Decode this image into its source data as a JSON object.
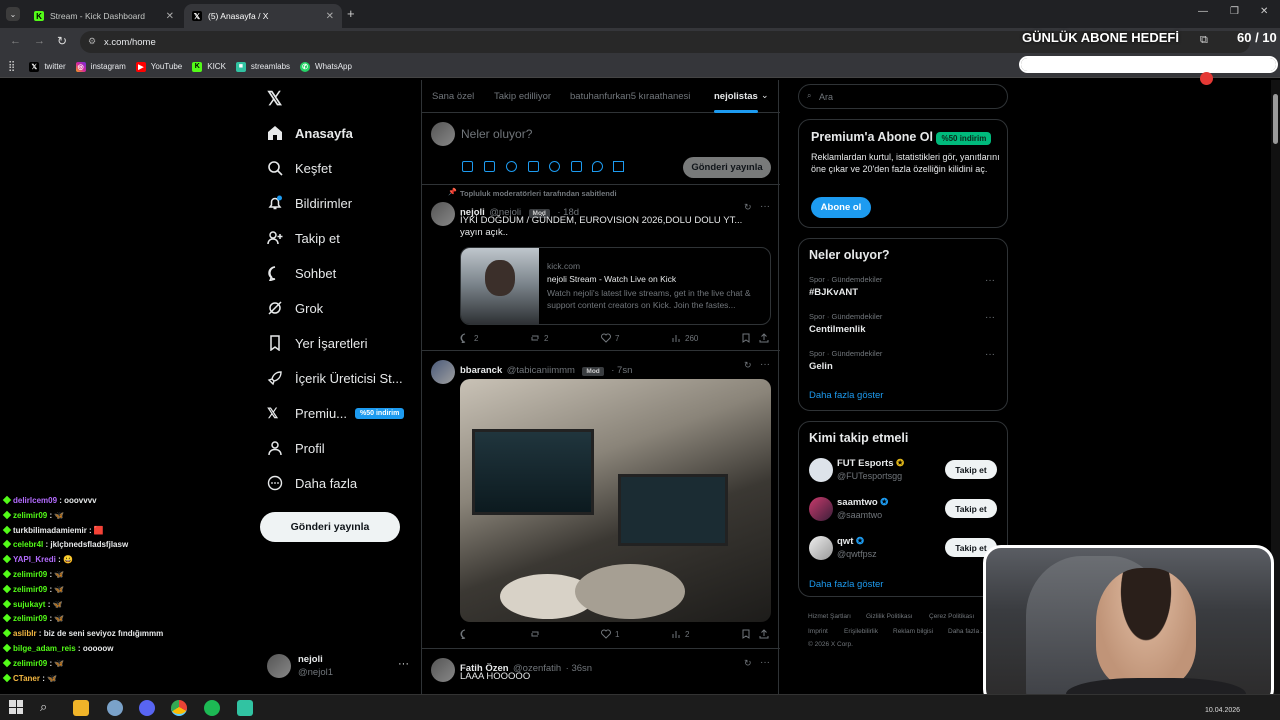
{
  "browser": {
    "tabs": [
      {
        "title": "Stream - Kick Dashboard",
        "icon": "kick-icon"
      },
      {
        "title": "(5) Anasayfa / X",
        "icon": "x-logo-icon"
      }
    ],
    "url": "x.com/home",
    "bookmarks": [
      {
        "label": "twitter",
        "icon": "x-logo-icon"
      },
      {
        "label": "instagram",
        "icon": "instagram-icon"
      },
      {
        "label": "YouTube",
        "icon": "youtube-icon"
      },
      {
        "label": "KICK",
        "icon": "kick-icon"
      },
      {
        "label": "streamlabs",
        "icon": "streamlabs-icon"
      },
      {
        "label": "WhatsApp",
        "icon": "whatsapp-icon"
      }
    ]
  },
  "overlay": {
    "goal_title": "GÜNLÜK ABONE HEDEFİ",
    "goal_count": "60 / 10",
    "goal_progress": 1.0
  },
  "nav": {
    "items": [
      {
        "label": "Anasayfa",
        "icon": "home-icon"
      },
      {
        "label": "Keşfet",
        "icon": "search-icon"
      },
      {
        "label": "Bildirimler",
        "icon": "bell-icon"
      },
      {
        "label": "Takip et",
        "icon": "add-person-icon"
      },
      {
        "label": "Sohbet",
        "icon": "chat-bubble-icon"
      },
      {
        "label": "Grok",
        "icon": "grok-icon"
      },
      {
        "label": "Yer İşaretleri",
        "icon": "bookmark-icon"
      },
      {
        "label": "İçerik Üreticisi St...",
        "icon": "rocket-icon"
      },
      {
        "label": "Premiu...",
        "icon": "x-logo-icon"
      },
      {
        "label": "Profil",
        "icon": "person-icon"
      },
      {
        "label": "Daha fazla",
        "icon": "more-circle-icon"
      }
    ],
    "premium_badge": "%50 indirim",
    "post_button": "Gönderi yayınla",
    "account": {
      "name": "nejoli",
      "handle": "@nejol1"
    }
  },
  "timeline": {
    "tabs": [
      "Sana özel",
      "Takip edilliyor",
      "batuhanfurkan5 kıraathanesi",
      "nejolistas"
    ],
    "composer": {
      "placeholder": "Neler oluyor?",
      "post_button": "Gönderi yayınla"
    },
    "pinned_label": "Topluluk moderatörleri tarafından sabitlendi",
    "posts": [
      {
        "name": "nejoli",
        "handle": "@nejoli",
        "badge": "Mod",
        "time": "18d",
        "text_line1": "İYKİ DOĞDUM / GÜNDEM, EUROVISION 2026,DOLU DOLU YT...",
        "text_line2": "yayın açık..",
        "card": {
          "domain": "kick.com",
          "title": "nejoli Stream - Watch Live on Kick",
          "description": "Watch nejoli's latest live streams, get in the live chat & support content creators on Kick. Join the fastes..."
        },
        "replies": "2",
        "reposts": "2",
        "likes": "7",
        "views": "260"
      },
      {
        "name": "bbaranck",
        "handle": "@tabicaniimmm",
        "badge": "Mod",
        "time": "7sn",
        "replies": "",
        "reposts": "",
        "likes": "1",
        "views": "2"
      },
      {
        "name": "Fatih Özen",
        "handle": "@ozenfatih",
        "time": "36sn",
        "text": "LAAA HOOOOO"
      }
    ]
  },
  "sidebar": {
    "search_placeholder": "Ara",
    "premium": {
      "title": "Premium'a Abone Ol",
      "badge": "%50 indirim",
      "text": "Reklamlardan kurtul, istatistikleri gör, yanıtlarını öne çıkar ve 20'den fazla özelliğin kilidini aç.",
      "button": "Abone ol"
    },
    "trends": {
      "title": "Neler oluyor?",
      "items": [
        {
          "category": "Spor · Gündemdekiler",
          "name": "#BJKvANT"
        },
        {
          "category": "Spor · Gündemdekiler",
          "name": "Centilmenlik"
        },
        {
          "category": "Spor · Gündemdekiler",
          "name": "Gelin"
        }
      ],
      "more": "Daha fazla göster"
    },
    "who_to_follow": {
      "title": "Kimi takip etmeli",
      "accounts": [
        {
          "name": "FUT Esports",
          "handle": "@FUTesportsgg",
          "verified": "gold"
        },
        {
          "name": "saamtwo",
          "handle": "@saamtwo",
          "verified": "blue"
        },
        {
          "name": "qwt",
          "handle": "@qwtfpsz",
          "verified": "blue"
        }
      ],
      "follow_button": "Takip et",
      "more": "Daha fazla göster"
    },
    "footer": [
      "Hizmet Şartları",
      "Gizlilik Politikası",
      "Çerez Politikası",
      "Imprint",
      "Erişilebilirlik",
      "Reklam bilgisi",
      "Daha fazla ...",
      "© 2026 X Corp."
    ]
  },
  "chat": {
    "lines": [
      {
        "user": "delirlcem09",
        "message": "ooovvvv",
        "color": "#b46cff"
      },
      {
        "user": "zelimir09",
        "message": "🦋",
        "color": "#53fc18"
      },
      {
        "user": "turkbilimadamiemir",
        "message": "🟥",
        "color": "#e7e9ea"
      },
      {
        "user": "celebr4l",
        "message": "jklçbnedsfladsfjlasw",
        "color": "#53fc18"
      },
      {
        "user": "YAPI_Kredi",
        "message": "😀",
        "color": "#b46cff"
      },
      {
        "user": "zelimir09",
        "message": "🦋",
        "color": "#53fc18"
      },
      {
        "user": "zelimir09",
        "message": "🦋",
        "color": "#53fc18"
      },
      {
        "user": "sujukayt",
        "message": "🦋",
        "color": "#53fc18"
      },
      {
        "user": "zelimir09",
        "message": "🦋",
        "color": "#53fc18"
      },
      {
        "user": "aslibIr",
        "message": "biz de seni seviyoz fındığımmm",
        "color": "#f5b942"
      },
      {
        "user": "bilge_adam_reis",
        "message": "ooooow",
        "color": "#53fc18"
      },
      {
        "user": "zelimir09",
        "message": "🦋",
        "color": "#53fc18"
      },
      {
        "user": "CTaner",
        "message": "🦋",
        "color": "#f5b942"
      }
    ]
  },
  "taskbar": {
    "date": "10.04.2026"
  },
  "colors": {
    "accent": "#1d9bf0",
    "kick_green": "#53fc18",
    "background": "#000000",
    "border": "#2f3336"
  }
}
